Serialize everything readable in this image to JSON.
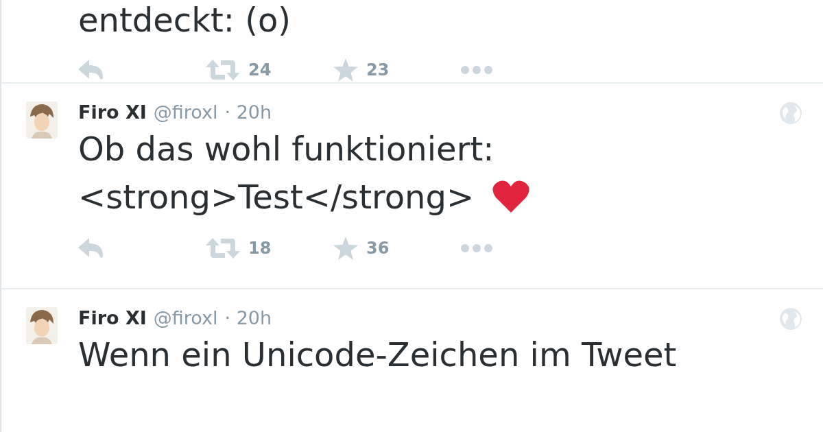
{
  "tweets": [
    {
      "text_lines": [
        "entdeckt: (o)"
      ],
      "actions": {
        "retweets": "24",
        "favorites": "23"
      }
    },
    {
      "author": {
        "name": "Firo XI",
        "handle": "@firoxl",
        "time": "· 20h"
      },
      "text_lines": [
        "Ob das wohl funktioniert:",
        "<strong>Test</strong>"
      ],
      "heart_emoji": true,
      "actions": {
        "retweets": "18",
        "favorites": "36"
      }
    },
    {
      "author": {
        "name": "Firo XI",
        "handle": "@firoxl",
        "time": "· 20h"
      },
      "text_lines": [
        "Wenn ein Unicode-Zeichen im Tweet"
      ]
    }
  ]
}
